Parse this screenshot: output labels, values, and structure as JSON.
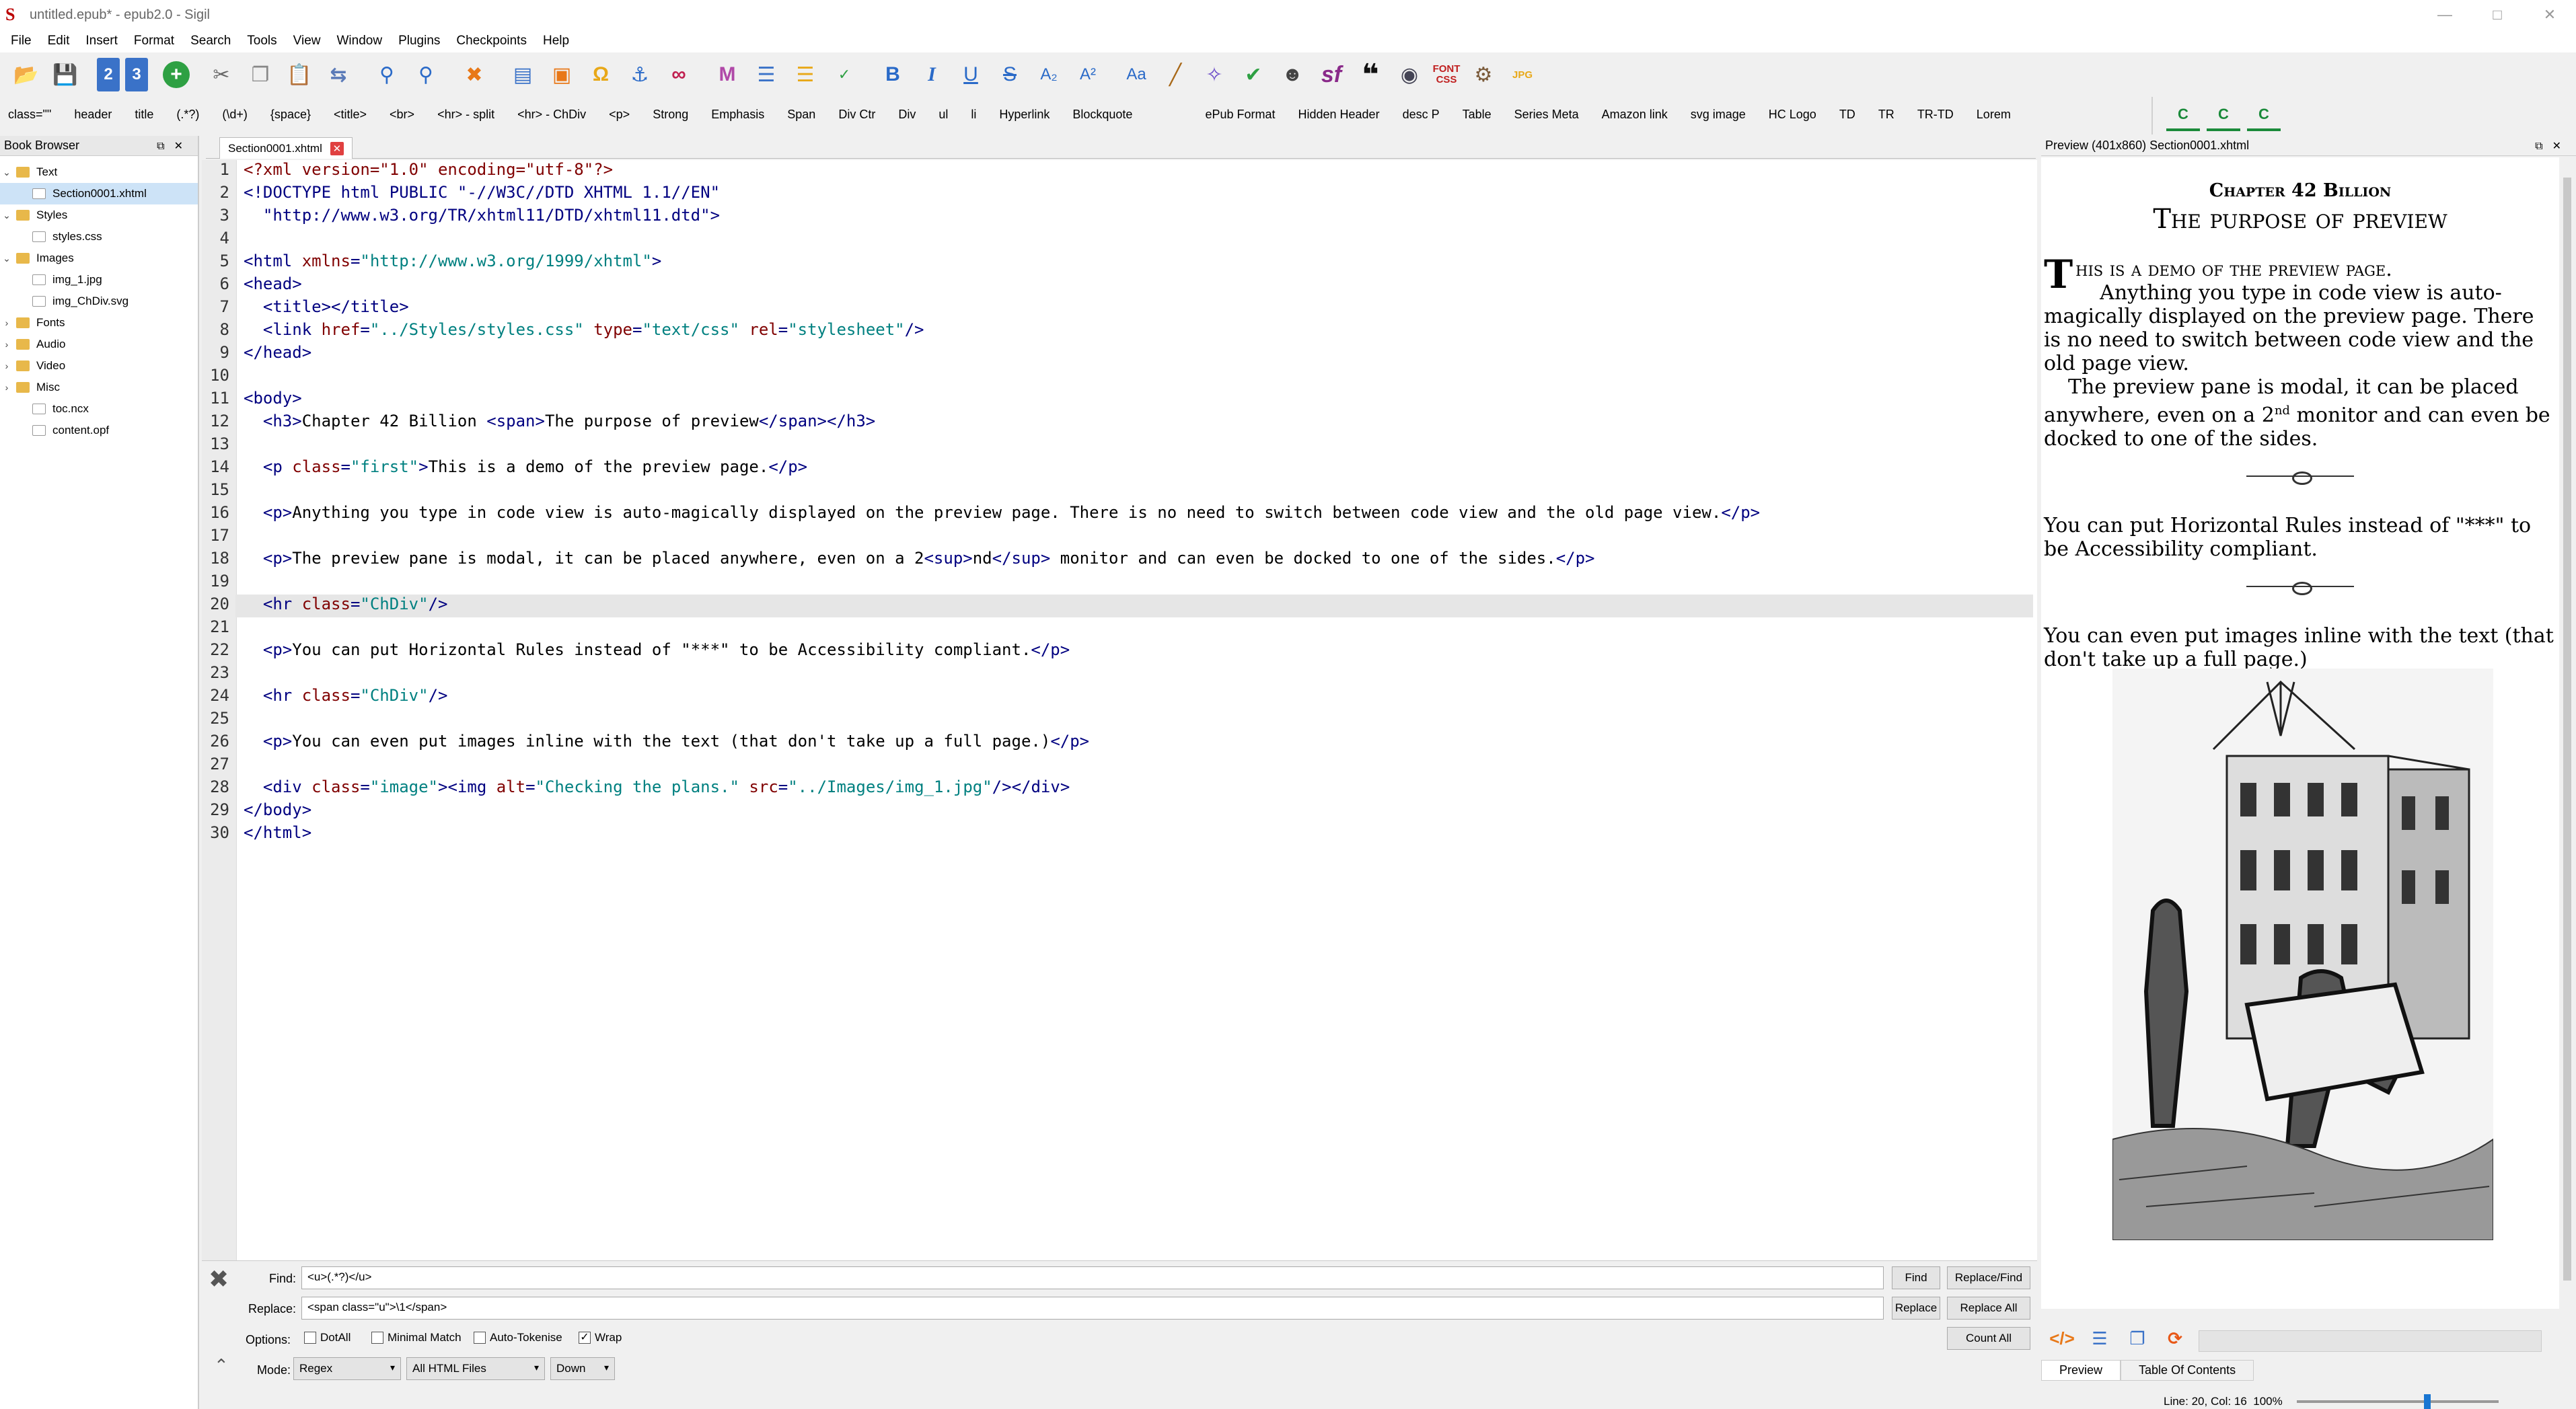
{
  "window": {
    "title": "untitled.epub* - epub2.0 - Sigil"
  },
  "menu": [
    "File",
    "Edit",
    "Insert",
    "Format",
    "Search",
    "Tools",
    "View",
    "Window",
    "Plugins",
    "Checkpoints",
    "Help"
  ],
  "toolbar_icons": [
    "open-folder-icon",
    "save-icon",
    "section-2-icon",
    "section-3-icon",
    "add-file-icon",
    "cut-icon",
    "copy-icon",
    "paste-icon",
    "split-icon",
    "find-icon",
    "find-next-icon",
    "cleanup-icon",
    "insert-file-icon",
    "insert-image-icon",
    "special-char-icon",
    "anchor-icon",
    "link-icon",
    "metadata-icon",
    "toc-list-icon",
    "toc-edit-icon",
    "spellcheck-icon",
    "bold-icon",
    "italic-icon",
    "underline-icon",
    "strikethrough-icon",
    "subscript-icon",
    "superscript-icon",
    "case-icon",
    "broom-icon",
    "validate-wand-icon",
    "check-icon",
    "epub-check-icon",
    "sf-icon",
    "quote-icon",
    "globe-icon",
    "font-css-icon",
    "plugin-icon",
    "jpg-icon"
  ],
  "toolbar_text": {
    "bold": "B",
    "italic": "I",
    "underline": "U",
    "strike": "S",
    "sub": "A₂",
    "sup": "A²",
    "case": "Aa",
    "sf": "sf",
    "fontcss": "FONT CSS",
    "jpg": "JPG"
  },
  "clipbar": [
    "class=\"\"",
    "header",
    "title",
    "(.*?)",
    "(\\d+)",
    "{space}",
    "<title>",
    "<br>",
    "<hr> - split",
    "<hr> - ChDiv",
    "<p>",
    "Strong",
    "Emphasis",
    "Span",
    "Div Ctr",
    "Div",
    "ul",
    "li",
    "Hyperlink",
    "Blockquote",
    "",
    "ePub Format",
    "Hidden Header",
    "desc P",
    "Table",
    "Series Meta",
    "Amazon link",
    "svg image",
    "HC Logo",
    "TD",
    "TR",
    "TR-TD",
    "Lorem"
  ],
  "cliptools": [
    "C",
    "C",
    "C"
  ],
  "book_browser": {
    "title": "Book Browser",
    "items": [
      {
        "label": "Text",
        "type": "folder",
        "expanded": true
      },
      {
        "label": "Section0001.xhtml",
        "type": "file",
        "selected": true
      },
      {
        "label": "Styles",
        "type": "folder",
        "expanded": true
      },
      {
        "label": "styles.css",
        "type": "file"
      },
      {
        "label": "Images",
        "type": "folder",
        "expanded": true
      },
      {
        "label": "img_1.jpg",
        "type": "file"
      },
      {
        "label": "img_ChDiv.svg",
        "type": "file"
      },
      {
        "label": "Fonts",
        "type": "folder"
      },
      {
        "label": "Audio",
        "type": "folder"
      },
      {
        "label": "Video",
        "type": "folder"
      },
      {
        "label": "Misc",
        "type": "folder"
      },
      {
        "label": "toc.ncx",
        "type": "file"
      },
      {
        "label": "content.opf",
        "type": "file"
      }
    ]
  },
  "editor": {
    "tab": "Section0001.xhtml",
    "current_line": 20,
    "lines": [
      [
        [
          "pi",
          "<?xml version=\"1.0\" encoding=\"utf-8\"?>"
        ]
      ],
      [
        [
          "tag",
          "<!DOCTYPE html PUBLIC \"-//W3C//DTD XHTML 1.1//EN\""
        ]
      ],
      [
        [
          "tag",
          "  \"http://www.w3.org/TR/xhtml11/DTD/xhtml11.dtd\">"
        ]
      ],
      [],
      [
        [
          "tag",
          "<html "
        ],
        [
          "att",
          "xmlns"
        ],
        [
          "tag",
          "="
        ],
        [
          "val",
          "\"http://www.w3.org/1999/xhtml\""
        ],
        [
          "tag",
          ">"
        ]
      ],
      [
        [
          "tag",
          "<head>"
        ]
      ],
      [
        [
          "txt",
          "  "
        ],
        [
          "tag",
          "<title></title>"
        ]
      ],
      [
        [
          "txt",
          "  "
        ],
        [
          "tag",
          "<link "
        ],
        [
          "att",
          "href"
        ],
        [
          "tag",
          "="
        ],
        [
          "val",
          "\"../Styles/styles.css\""
        ],
        [
          "txt",
          " "
        ],
        [
          "att",
          "type"
        ],
        [
          "tag",
          "="
        ],
        [
          "val",
          "\"text/css\""
        ],
        [
          "txt",
          " "
        ],
        [
          "att",
          "rel"
        ],
        [
          "tag",
          "="
        ],
        [
          "val",
          "\"stylesheet\""
        ],
        [
          "tag",
          "/>"
        ]
      ],
      [
        [
          "tag",
          "</head>"
        ]
      ],
      [],
      [
        [
          "tag",
          "<body>"
        ]
      ],
      [
        [
          "txt",
          "  "
        ],
        [
          "tag",
          "<h3>"
        ],
        [
          "txt",
          "Chapter 42 Billion "
        ],
        [
          "tag",
          "<span>"
        ],
        [
          "txt",
          "The purpose of preview"
        ],
        [
          "tag",
          "</span></h3>"
        ]
      ],
      [],
      [
        [
          "txt",
          "  "
        ],
        [
          "tag",
          "<p "
        ],
        [
          "att",
          "class"
        ],
        [
          "tag",
          "="
        ],
        [
          "val",
          "\"first\""
        ],
        [
          "tag",
          ">"
        ],
        [
          "txt",
          "This is a demo of the preview page."
        ],
        [
          "tag",
          "</p>"
        ]
      ],
      [],
      [
        [
          "txt",
          "  "
        ],
        [
          "tag",
          "<p>"
        ],
        [
          "txt",
          "Anything you type in code view is auto-magically displayed on the preview page. There is no need to switch between code view and the old page view."
        ],
        [
          "tag",
          "</p>"
        ]
      ],
      [],
      [
        [
          "txt",
          "  "
        ],
        [
          "tag",
          "<p>"
        ],
        [
          "txt",
          "The preview pane is modal, it can be placed anywhere, even on a 2"
        ],
        [
          "tag",
          "<sup>"
        ],
        [
          "txt",
          "nd"
        ],
        [
          "tag",
          "</sup>"
        ],
        [
          "txt",
          " monitor and can even be docked to one of the sides."
        ],
        [
          "tag",
          "</p>"
        ]
      ],
      [],
      [
        [
          "txt",
          "  "
        ],
        [
          "tag",
          "<hr "
        ],
        [
          "att",
          "class"
        ],
        [
          "tag",
          "="
        ],
        [
          "val",
          "\"ChDiv\""
        ],
        [
          "tag",
          "/>"
        ]
      ],
      [],
      [
        [
          "txt",
          "  "
        ],
        [
          "tag",
          "<p>"
        ],
        [
          "txt",
          "You can put Horizontal Rules instead of \"***\" to be Accessibility compliant."
        ],
        [
          "tag",
          "</p>"
        ]
      ],
      [],
      [
        [
          "txt",
          "  "
        ],
        [
          "tag",
          "<hr "
        ],
        [
          "att",
          "class"
        ],
        [
          "tag",
          "="
        ],
        [
          "val",
          "\"ChDiv\""
        ],
        [
          "tag",
          "/>"
        ]
      ],
      [],
      [
        [
          "txt",
          "  "
        ],
        [
          "tag",
          "<p>"
        ],
        [
          "txt",
          "You can even put images inline with the text (that don't take up a full page.)"
        ],
        [
          "tag",
          "</p>"
        ]
      ],
      [],
      [
        [
          "txt",
          "  "
        ],
        [
          "tag",
          "<div "
        ],
        [
          "att",
          "class"
        ],
        [
          "tag",
          "="
        ],
        [
          "val",
          "\"image\""
        ],
        [
          "tag",
          "><img "
        ],
        [
          "att",
          "alt"
        ],
        [
          "tag",
          "="
        ],
        [
          "val",
          "\"Checking the plans.\""
        ],
        [
          "txt",
          " "
        ],
        [
          "att",
          "src"
        ],
        [
          "tag",
          "="
        ],
        [
          "val",
          "\"../Images/img_1.jpg\""
        ],
        [
          "tag",
          "/></div>"
        ]
      ],
      [
        [
          "tag",
          "</body>"
        ]
      ],
      [
        [
          "tag",
          "</html>"
        ]
      ]
    ]
  },
  "preview": {
    "title": "Preview (401x860) Section0001.xhtml",
    "chapter": "Chapter 42 Billion",
    "subtitle": "The purpose of preview",
    "first_drop": "T",
    "first_rest": "his is a demo of the preview page.",
    "p1": "Anything you type in code view is auto-magically displayed on the preview page. There is no need to switch between code view and the old page view.",
    "p2_a": "The preview pane is modal, it can be placed anywhere, even on a 2",
    "p2_sup": "nd",
    "p2_b": " monitor and can even be docked to one of the sides.",
    "p3": "You can put Horizontal Rules instead of \"***\" to be Accessibility compliant.",
    "p4": "You can even put images inline with the text (that don't take up a full page.)",
    "tabs": [
      "Preview",
      "Table Of Contents"
    ]
  },
  "status": {
    "text": "Line: 20, Col: 16",
    "zoom": "100%",
    "zoom_level": 0.63
  },
  "find": {
    "find_label": "Find:",
    "find_value": "<u>(.*?)</u>",
    "replace_label": "Replace:",
    "replace_value": "<span class=\"u\">\\1</span>",
    "options_label": "Options:",
    "mode_label": "Mode:",
    "buttons": {
      "find": "Find",
      "replace_find": "Replace/Find",
      "replace": "Replace",
      "replace_all": "Replace All",
      "count_all": "Count All"
    },
    "options": [
      {
        "label": "DotAll",
        "checked": false
      },
      {
        "label": "Minimal Match",
        "checked": false
      },
      {
        "label": "Auto-Tokenise",
        "checked": false
      },
      {
        "label": "Wrap",
        "checked": true
      }
    ],
    "mode": "Regex",
    "scope": "All HTML Files",
    "direction": "Down"
  },
  "colors": {
    "tag": "#000080",
    "attr": "#800000",
    "value": "#008080",
    "accent": "#1976d2"
  }
}
